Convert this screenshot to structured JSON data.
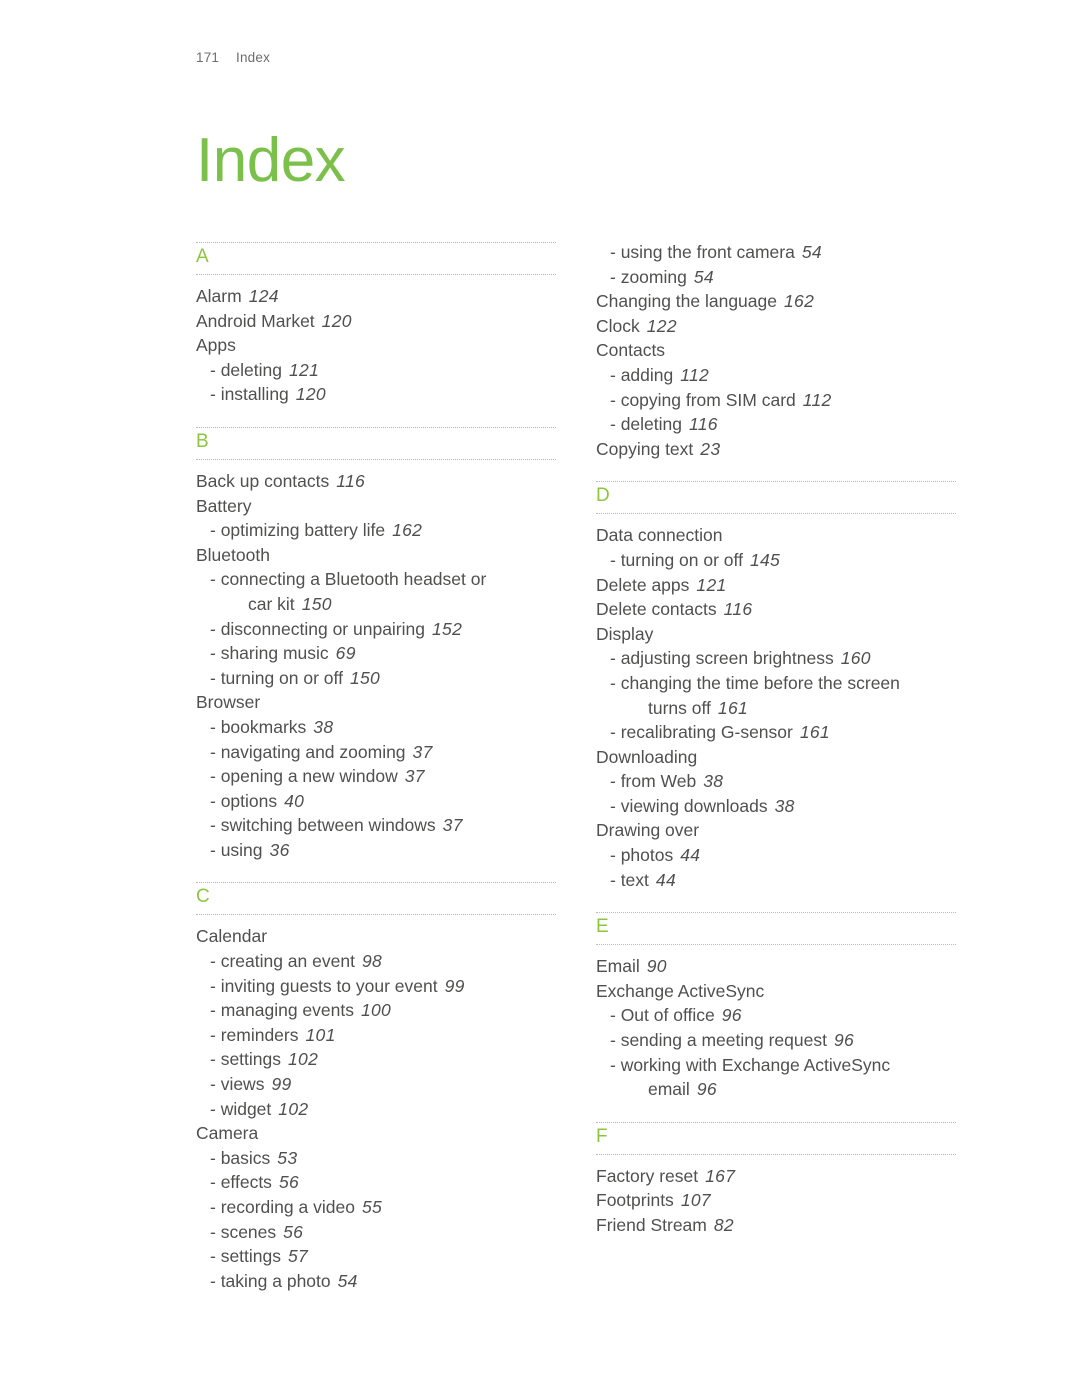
{
  "header": {
    "folio": "171",
    "label": "Index"
  },
  "title": "Index",
  "colors": {
    "accent_green": "#7cc04c",
    "letter_green": "#8cc63f",
    "body_text": "#50504f",
    "rule_gray": "#b9b9b9"
  },
  "columns": {
    "left": [
      {
        "letter": "A",
        "entries": [
          {
            "level": 0,
            "text": "Alarm",
            "page": "124"
          },
          {
            "level": 0,
            "text": "Android Market",
            "page": "120"
          },
          {
            "level": 0,
            "text": "Apps",
            "page": ""
          },
          {
            "level": 1,
            "text": "- deleting",
            "page": "121"
          },
          {
            "level": 1,
            "text": "- installing",
            "page": "120"
          }
        ]
      },
      {
        "letter": "B",
        "entries": [
          {
            "level": 0,
            "text": "Back up contacts",
            "page": "116"
          },
          {
            "level": 0,
            "text": "Battery",
            "page": ""
          },
          {
            "level": 1,
            "text": "- optimizing battery life",
            "page": "162"
          },
          {
            "level": 0,
            "text": "Bluetooth",
            "page": ""
          },
          {
            "level": 1,
            "text": "- connecting a Bluetooth headset or",
            "cont": "car kit",
            "page": "150"
          },
          {
            "level": 1,
            "text": "- disconnecting or unpairing",
            "page": "152"
          },
          {
            "level": 1,
            "text": "- sharing music",
            "page": "69"
          },
          {
            "level": 1,
            "text": "- turning on or off",
            "page": "150"
          },
          {
            "level": 0,
            "text": "Browser",
            "page": ""
          },
          {
            "level": 1,
            "text": "- bookmarks",
            "page": "38"
          },
          {
            "level": 1,
            "text": "- navigating and zooming",
            "page": "37"
          },
          {
            "level": 1,
            "text": "- opening a new window",
            "page": "37"
          },
          {
            "level": 1,
            "text": "- options",
            "page": "40"
          },
          {
            "level": 1,
            "text": "- switching between windows",
            "page": "37"
          },
          {
            "level": 1,
            "text": "- using",
            "page": "36"
          }
        ]
      },
      {
        "letter": "C",
        "entries": [
          {
            "level": 0,
            "text": "Calendar",
            "page": ""
          },
          {
            "level": 1,
            "text": "- creating an event",
            "page": "98"
          },
          {
            "level": 1,
            "text": "- inviting guests to your event",
            "page": "99"
          },
          {
            "level": 1,
            "text": "- managing events",
            "page": "100"
          },
          {
            "level": 1,
            "text": "- reminders",
            "page": "101"
          },
          {
            "level": 1,
            "text": "- settings",
            "page": "102"
          },
          {
            "level": 1,
            "text": "- views",
            "page": "99"
          },
          {
            "level": 1,
            "text": "- widget",
            "page": "102"
          },
          {
            "level": 0,
            "text": "Camera",
            "page": ""
          },
          {
            "level": 1,
            "text": "- basics",
            "page": "53"
          },
          {
            "level": 1,
            "text": "- effects",
            "page": "56"
          },
          {
            "level": 1,
            "text": "- recording a video",
            "page": "55"
          },
          {
            "level": 1,
            "text": "- scenes",
            "page": "56"
          },
          {
            "level": 1,
            "text": "- settings",
            "page": "57"
          },
          {
            "level": 1,
            "text": "- taking a photo",
            "page": "54"
          }
        ]
      }
    ],
    "right": [
      {
        "letter": "",
        "entries": [
          {
            "level": 1,
            "text": "- using the front camera",
            "page": "54"
          },
          {
            "level": 1,
            "text": "- zooming",
            "page": "54"
          },
          {
            "level": 0,
            "text": "Changing the language",
            "page": "162"
          },
          {
            "level": 0,
            "text": "Clock",
            "page": "122"
          },
          {
            "level": 0,
            "text": "Contacts",
            "page": ""
          },
          {
            "level": 1,
            "text": "- adding",
            "page": "112"
          },
          {
            "level": 1,
            "text": "- copying from SIM card",
            "page": "112"
          },
          {
            "level": 1,
            "text": "- deleting",
            "page": "116"
          },
          {
            "level": 0,
            "text": "Copying text",
            "page": "23"
          }
        ]
      },
      {
        "letter": "D",
        "entries": [
          {
            "level": 0,
            "text": "Data connection",
            "page": ""
          },
          {
            "level": 1,
            "text": "- turning on or off",
            "page": "145"
          },
          {
            "level": 0,
            "text": "Delete apps",
            "page": "121"
          },
          {
            "level": 0,
            "text": "Delete contacts",
            "page": "116"
          },
          {
            "level": 0,
            "text": "Display",
            "page": ""
          },
          {
            "level": 1,
            "text": "- adjusting screen brightness",
            "page": "160"
          },
          {
            "level": 1,
            "text": "- changing the time before the screen",
            "cont": "turns off",
            "page": "161"
          },
          {
            "level": 1,
            "text": "- recalibrating G-sensor",
            "page": "161"
          },
          {
            "level": 0,
            "text": "Downloading",
            "page": ""
          },
          {
            "level": 1,
            "text": "- from Web",
            "page": "38"
          },
          {
            "level": 1,
            "text": "- viewing downloads",
            "page": "38"
          },
          {
            "level": 0,
            "text": "Drawing over",
            "page": ""
          },
          {
            "level": 1,
            "text": "- photos",
            "page": "44"
          },
          {
            "level": 1,
            "text": "- text",
            "page": "44"
          }
        ]
      },
      {
        "letter": "E",
        "entries": [
          {
            "level": 0,
            "text": "Email",
            "page": "90"
          },
          {
            "level": 0,
            "text": "Exchange ActiveSync",
            "page": ""
          },
          {
            "level": 1,
            "text": "- Out of office",
            "page": "96"
          },
          {
            "level": 1,
            "text": "- sending a meeting request",
            "page": "96"
          },
          {
            "level": 1,
            "text": "- working with Exchange ActiveSync",
            "cont": "email",
            "page": "96"
          }
        ]
      },
      {
        "letter": "F",
        "entries": [
          {
            "level": 0,
            "text": "Factory reset",
            "page": "167"
          },
          {
            "level": 0,
            "text": "Footprints",
            "page": "107"
          },
          {
            "level": 0,
            "text": "Friend Stream",
            "page": "82"
          }
        ]
      }
    ]
  }
}
